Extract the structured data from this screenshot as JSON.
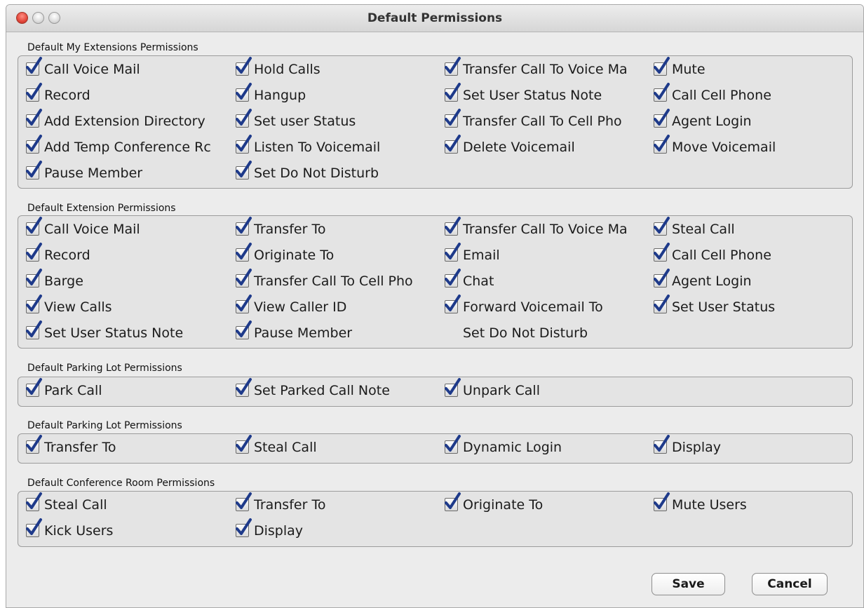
{
  "window": {
    "title": "Default Permissions"
  },
  "sections": [
    {
      "label": "Default My Extensions Permissions",
      "items": [
        {
          "label": "Call Voice Mail",
          "checked": true
        },
        {
          "label": "Hold Calls",
          "checked": true
        },
        {
          "label": "Transfer Call To Voice Ma",
          "checked": true
        },
        {
          "label": "Mute",
          "checked": true
        },
        {
          "label": "Record",
          "checked": true
        },
        {
          "label": "Hangup",
          "checked": true
        },
        {
          "label": "Set User Status Note",
          "checked": true
        },
        {
          "label": "Call Cell Phone",
          "checked": true
        },
        {
          "label": "Add Extension Directory",
          "checked": true
        },
        {
          "label": "Set user Status",
          "checked": true
        },
        {
          "label": "Transfer Call To Cell Pho",
          "checked": true
        },
        {
          "label": "Agent Login",
          "checked": true
        },
        {
          "label": "Add Temp Conference Rc",
          "checked": true
        },
        {
          "label": "Listen To Voicemail",
          "checked": true
        },
        {
          "label": "Delete Voicemail",
          "checked": true
        },
        {
          "label": "Move Voicemail",
          "checked": true
        },
        {
          "label": "Pause Member",
          "checked": true
        },
        {
          "label": "Set Do Not Disturb",
          "checked": true
        }
      ]
    },
    {
      "label": "Default Extension Permissions",
      "items": [
        {
          "label": "Call Voice Mail",
          "checked": true
        },
        {
          "label": "Transfer To",
          "checked": true
        },
        {
          "label": "Transfer Call To Voice Ma",
          "checked": true
        },
        {
          "label": "Steal Call",
          "checked": true
        },
        {
          "label": "Record",
          "checked": true
        },
        {
          "label": "Originate To",
          "checked": true
        },
        {
          "label": "Email",
          "checked": true
        },
        {
          "label": "Call Cell Phone",
          "checked": true
        },
        {
          "label": "Barge",
          "checked": true
        },
        {
          "label": "Transfer Call To Cell Pho",
          "checked": true
        },
        {
          "label": "Chat",
          "checked": true
        },
        {
          "label": "Agent Login",
          "checked": true
        },
        {
          "label": "View Calls",
          "checked": true
        },
        {
          "label": "View Caller ID",
          "checked": true
        },
        {
          "label": "Forward Voicemail To",
          "checked": true
        },
        {
          "label": "Set User Status",
          "checked": true
        },
        {
          "label": "Set User Status Note",
          "checked": true
        },
        {
          "label": "Pause Member",
          "checked": true
        },
        {
          "label": "Set Do Not Disturb",
          "checked": false
        }
      ]
    },
    {
      "label": "Default Parking Lot Permissions",
      "items": [
        {
          "label": "Park Call",
          "checked": true
        },
        {
          "label": "Set Parked Call Note",
          "checked": true
        },
        {
          "label": "Unpark Call",
          "checked": true
        }
      ]
    },
    {
      "label": "Default Parking Lot Permissions",
      "items": [
        {
          "label": "Transfer To",
          "checked": true
        },
        {
          "label": "Steal Call",
          "checked": true
        },
        {
          "label": "Dynamic Login",
          "checked": true
        },
        {
          "label": "Display",
          "checked": true
        }
      ]
    },
    {
      "label": "Default Conference Room Permissions",
      "items": [
        {
          "label": "Steal Call",
          "checked": true
        },
        {
          "label": "Transfer To",
          "checked": true
        },
        {
          "label": "Originate To",
          "checked": true
        },
        {
          "label": "Mute Users",
          "checked": true
        },
        {
          "label": "Kick Users",
          "checked": true
        },
        {
          "label": "Display",
          "checked": true
        }
      ]
    }
  ],
  "buttons": {
    "save": "Save",
    "cancel": "Cancel"
  },
  "colors": {
    "checkmark": "#1e3a8a",
    "panel_bg": "#e4e4e4",
    "window_bg": "#ececec"
  }
}
